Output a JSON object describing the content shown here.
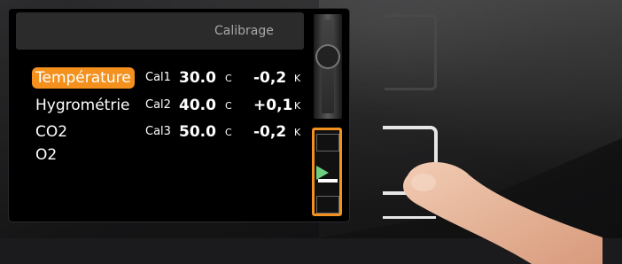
{
  "header": {
    "title": "Calibrage"
  },
  "rows": [
    {
      "label": "Température",
      "cal": "Cal1",
      "value": "30.0",
      "unit": "C",
      "delta": "-0,2",
      "delta_unit": "K",
      "active": true
    },
    {
      "label": "Hygrométrie",
      "cal": "Cal2",
      "value": "40.0",
      "unit": "C",
      "delta": "+0,1",
      "delta_unit": "K",
      "active": false
    },
    {
      "label": "CO2",
      "cal": "Cal3",
      "value": "50.0",
      "unit": "C",
      "delta": "-0,2",
      "delta_unit": "K",
      "active": false
    },
    {
      "label": "O2"
    }
  ],
  "colors": {
    "accent": "#f4911e",
    "screen": "#000000",
    "header": "#2b2b2b"
  }
}
